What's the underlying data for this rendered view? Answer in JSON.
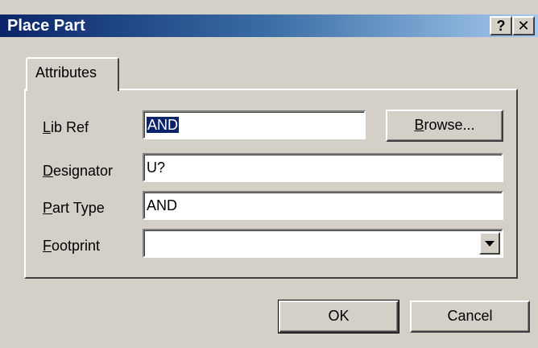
{
  "window": {
    "title": "Place Part",
    "help_button": "?",
    "close_button": "✕"
  },
  "tabs": [
    {
      "label": "Attributes",
      "active": true
    }
  ],
  "fields": {
    "lib_ref": {
      "label_mnemonic": "L",
      "label_rest": "ib Ref",
      "value": "AND"
    },
    "designator": {
      "label_mnemonic": "D",
      "label_rest": "esignator",
      "value": "U?"
    },
    "part_type": {
      "label_mnemonic": "P",
      "label_rest": "art Type",
      "value": "AND"
    },
    "footprint": {
      "label_mnemonic": "F",
      "label_rest": "ootprint",
      "value": ""
    }
  },
  "buttons": {
    "browse_mnemonic": "B",
    "browse_rest": "rowse...",
    "ok": "OK",
    "cancel": "Cancel"
  },
  "icons": {
    "dropdown": "chevron-down-icon"
  },
  "colors": {
    "face": "#d4d0c8",
    "title_start": "#0a246a",
    "title_end": "#a6caf0",
    "selection": "#0a246a"
  }
}
